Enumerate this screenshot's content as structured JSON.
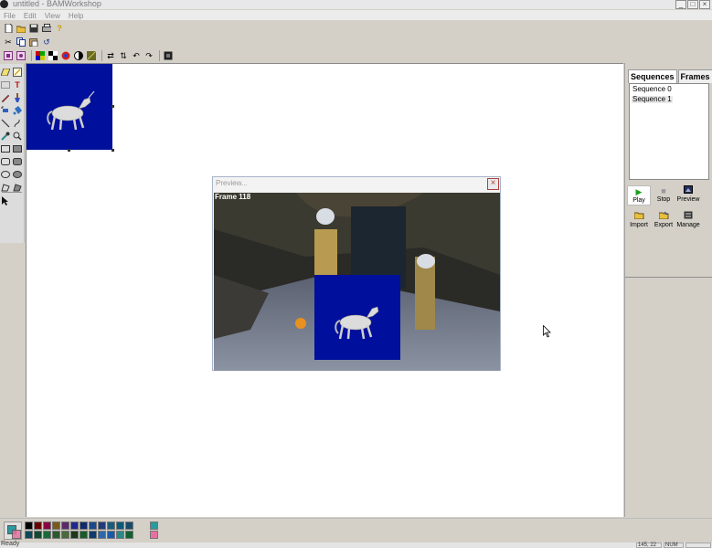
{
  "window": {
    "title": "untitled - BAMWorkshop",
    "controls": {
      "minimize": "_",
      "maximize": "□",
      "close": "×"
    }
  },
  "menu": [
    "File",
    "Edit",
    "View",
    "Help"
  ],
  "toolbar_row1": [
    "new-file-icon",
    "open-folder-icon",
    "save-icon",
    "print-icon",
    "help-icon"
  ],
  "toolbar_row2": [
    "cut-icon",
    "copy-icon",
    "paste-icon",
    "undo-icon"
  ],
  "toolbar_row3": [
    "frame-icon",
    "frame-alt-icon",
    "palette-icon",
    "transparency-icon",
    "color-wheel-icon",
    "contrast-icon",
    "texture-icon",
    "flip-horizontal-icon",
    "flip-vertical-icon",
    "rotate-left-icon",
    "rotate-right-icon",
    "frame-stop-icon"
  ],
  "tools": [
    "eraser-icon",
    "fill-icon",
    "select-rect-icon",
    "text-icon",
    "pencil-icon",
    "brush-icon",
    "airbrush-icon",
    "paint-bucket-icon",
    "line-icon",
    "curve-icon",
    "eyedropper-icon",
    "zoom-icon",
    "rectangle-icon",
    "filled-rectangle-icon",
    "rounded-rect-icon",
    "filled-rounded-rect-icon",
    "ellipse-icon",
    "filled-ellipse-icon",
    "polygon-icon",
    "filled-polygon-icon",
    "pointer-icon"
  ],
  "preview": {
    "title": "Preview...",
    "frame_label": "Frame 118"
  },
  "right_panel": {
    "tabs": [
      "Sequences",
      "Frames"
    ],
    "sequences": [
      "Sequence 0",
      "Sequence 1"
    ],
    "selected_sequence": 1,
    "buttons": {
      "play": "Play",
      "stop": "Stop",
      "preview": "Preview",
      "import": "Import",
      "export": "Export",
      "manage": "Manage"
    }
  },
  "palette": {
    "primary": "#2a9aa0",
    "secondary": "#e870a0",
    "colors": [
      "#000000",
      "#6b0000",
      "#8a0040",
      "#7a5a1a",
      "#5a2a6a",
      "#202890",
      "#102a6a",
      "#1a4a8a",
      "#203a7a",
      "#1a5a7a",
      "#0a5a7a",
      "#1a4a6a",
      "#0a4a5a",
      "#104a30",
      "#1a6a3a",
      "#2a5a30",
      "#4a6a3a",
      "#1a3a1a",
      "#1a5a2a",
      "#103a6a",
      "#2a6aaa",
      "#1a5aaa",
      "#2a8a8a",
      "#106030"
    ]
  },
  "status": {
    "text": "Ready",
    "coords": "145, 22",
    "num": "NUM"
  },
  "colors": {
    "frame_bg": "#000f9c",
    "canvas_bg": "#ffffff"
  }
}
